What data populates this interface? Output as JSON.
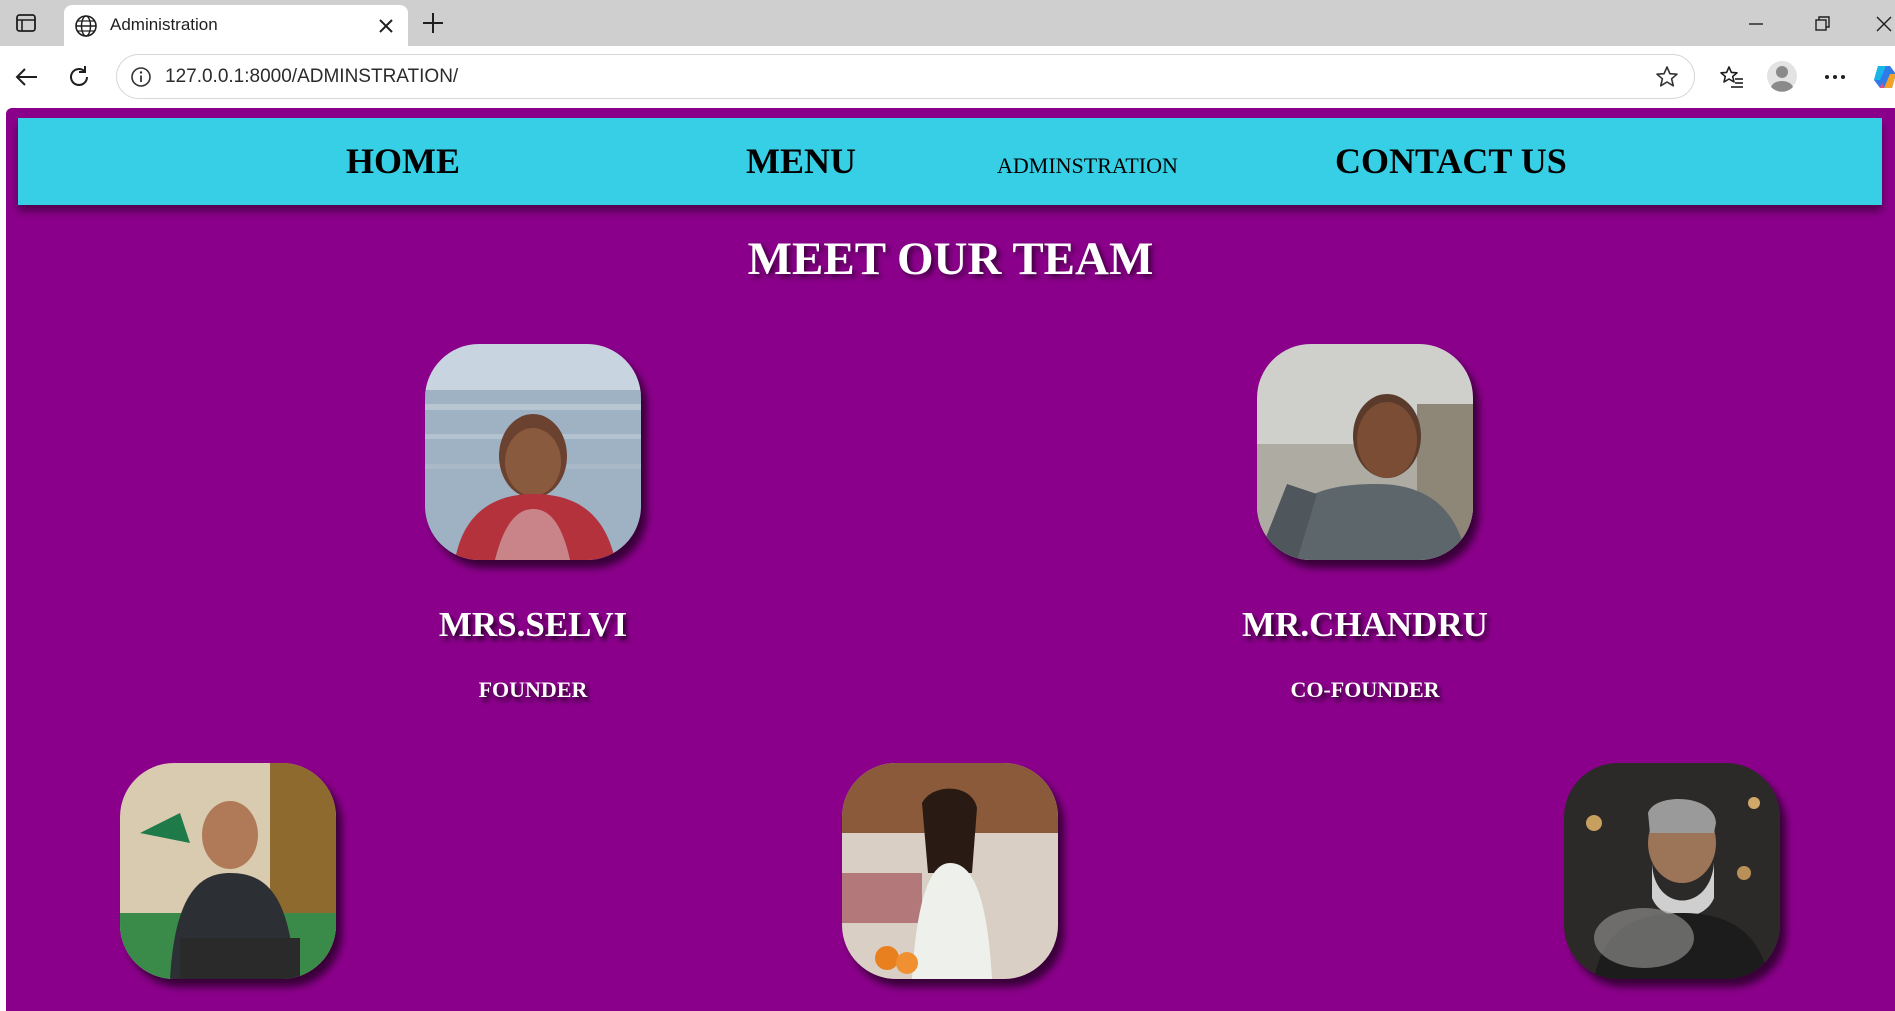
{
  "browser": {
    "tab_title": "Administration",
    "url": "127.0.0.1:8000/ADMINSTRATION/",
    "icons": [
      "sidebar-toggle-icon",
      "globe-icon",
      "close-icon",
      "plus-icon",
      "back-arrow-icon",
      "reload-icon",
      "info-icon",
      "star-icon",
      "favorites-icon",
      "profile-icon",
      "more-icon",
      "copilot-icon",
      "minimize-icon",
      "restore-icon",
      "window-close-icon"
    ]
  },
  "navbar": {
    "home": "HOME",
    "menu": "MENU",
    "administration": "ADMINSTRATION",
    "contact": "CONTACT US",
    "background": "#36cfe5"
  },
  "page": {
    "background": "#8b008b",
    "title": "MEET OUR TEAM"
  },
  "team": {
    "founders": [
      {
        "name": "MRS.SELVI",
        "role": "FOUNDER"
      },
      {
        "name": "MR.CHANDRU",
        "role": "CO-FOUNDER"
      }
    ]
  }
}
